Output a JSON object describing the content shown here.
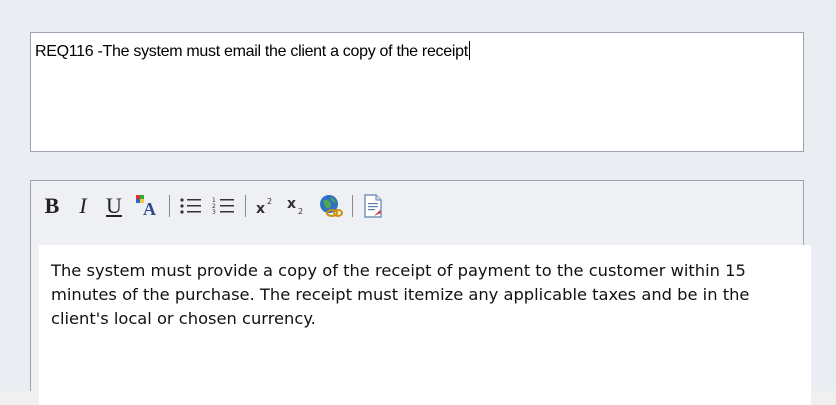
{
  "requirement": {
    "name_value": "REQ116 -The system must email the client a copy of the receipt"
  },
  "toolbar": {
    "bold_label": "B",
    "italic_label": "I",
    "underline_label": "U",
    "icons": [
      "font-color-icon",
      "bullet-list-icon",
      "numbered-list-icon",
      "superscript-icon",
      "subscript-icon",
      "hyperlink-icon",
      "linked-document-icon"
    ]
  },
  "notes": {
    "text": "The system must provide a copy of the receipt of payment to the customer within 15 minutes of the purchase. The receipt must itemize any applicable taxes and be in the client's local or chosen currency."
  },
  "colors": {
    "panel_bg": "#eaedf2",
    "border": "#9aa3b0",
    "field_bg": "#ffffff"
  }
}
